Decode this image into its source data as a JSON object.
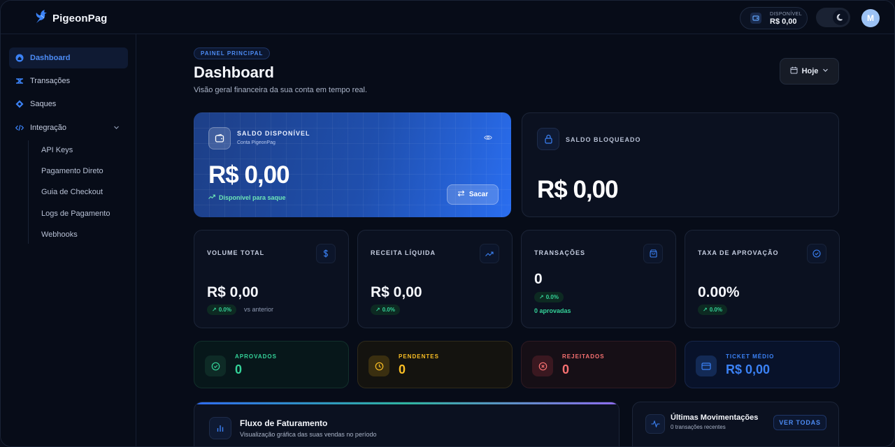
{
  "app": {
    "name": "PigeonPag"
  },
  "topbar": {
    "balance_label": "DISPONÍVEL",
    "balance_value": "R$ 0,00",
    "avatar_initial": "M"
  },
  "sidebar": {
    "items": [
      {
        "label": "Dashboard",
        "icon": "home-icon",
        "active": true
      },
      {
        "label": "Transações",
        "icon": "transactions-icon",
        "active": false
      },
      {
        "label": "Saques",
        "icon": "diamond-icon",
        "active": false
      },
      {
        "label": "Integração",
        "icon": "code-icon",
        "active": false
      }
    ],
    "sub_items": [
      "API Keys",
      "Pagamento Direto",
      "Guia de Checkout",
      "Logs de Pagamento",
      "Webhooks"
    ]
  },
  "header": {
    "badge": "PAINEL PRINCIPAL",
    "title": "Dashboard",
    "subtitle": "Visão geral financeira da sua conta em tempo real.",
    "date_filter": "Hoje"
  },
  "balance_card": {
    "title": "SALDO DISPONÍVEL",
    "subtitle": "Conta PigeonPag",
    "amount": "R$ 0,00",
    "status": "Disponível para saque",
    "action": "Sacar"
  },
  "blocked_card": {
    "title": "SALDO BLOQUEADO",
    "amount": "R$ 0,00"
  },
  "stats": [
    {
      "title": "VOLUME TOTAL",
      "value": "R$ 0,00",
      "change": "0.0%",
      "note": "vs anterior"
    },
    {
      "title": "RECEITA LÍQUIDA",
      "value": "R$ 0,00",
      "change": "0.0%"
    },
    {
      "title": "TRANSAÇÕES",
      "value": "0",
      "change": "0.0%",
      "note": "0 aprovadas"
    },
    {
      "title": "TAXA DE APROVAÇÃO",
      "value": "0.00%",
      "change": "0.0%"
    }
  ],
  "status_cards": [
    {
      "title": "APROVADOS",
      "value": "0",
      "color": "#34d399"
    },
    {
      "title": "PENDENTES",
      "value": "0",
      "color": "#fbbf24"
    },
    {
      "title": "REJEITADOS",
      "value": "0",
      "color": "#f87171"
    },
    {
      "title": "TICKET MÉDIO",
      "value": "R$ 0,00",
      "color": "#3b82f6"
    }
  ],
  "revenue_flow": {
    "title": "Fluxo de Faturamento",
    "subtitle": "Visualização gráfica das suas vendas no período"
  },
  "movements": {
    "title": "Últimas Movimentações",
    "subtitle": "0 transações recentes",
    "action": "VER TODAS"
  },
  "colors": {
    "accent": "#4d8cf5",
    "success": "#34d399",
    "warning": "#fbbf24",
    "danger": "#f87171"
  }
}
